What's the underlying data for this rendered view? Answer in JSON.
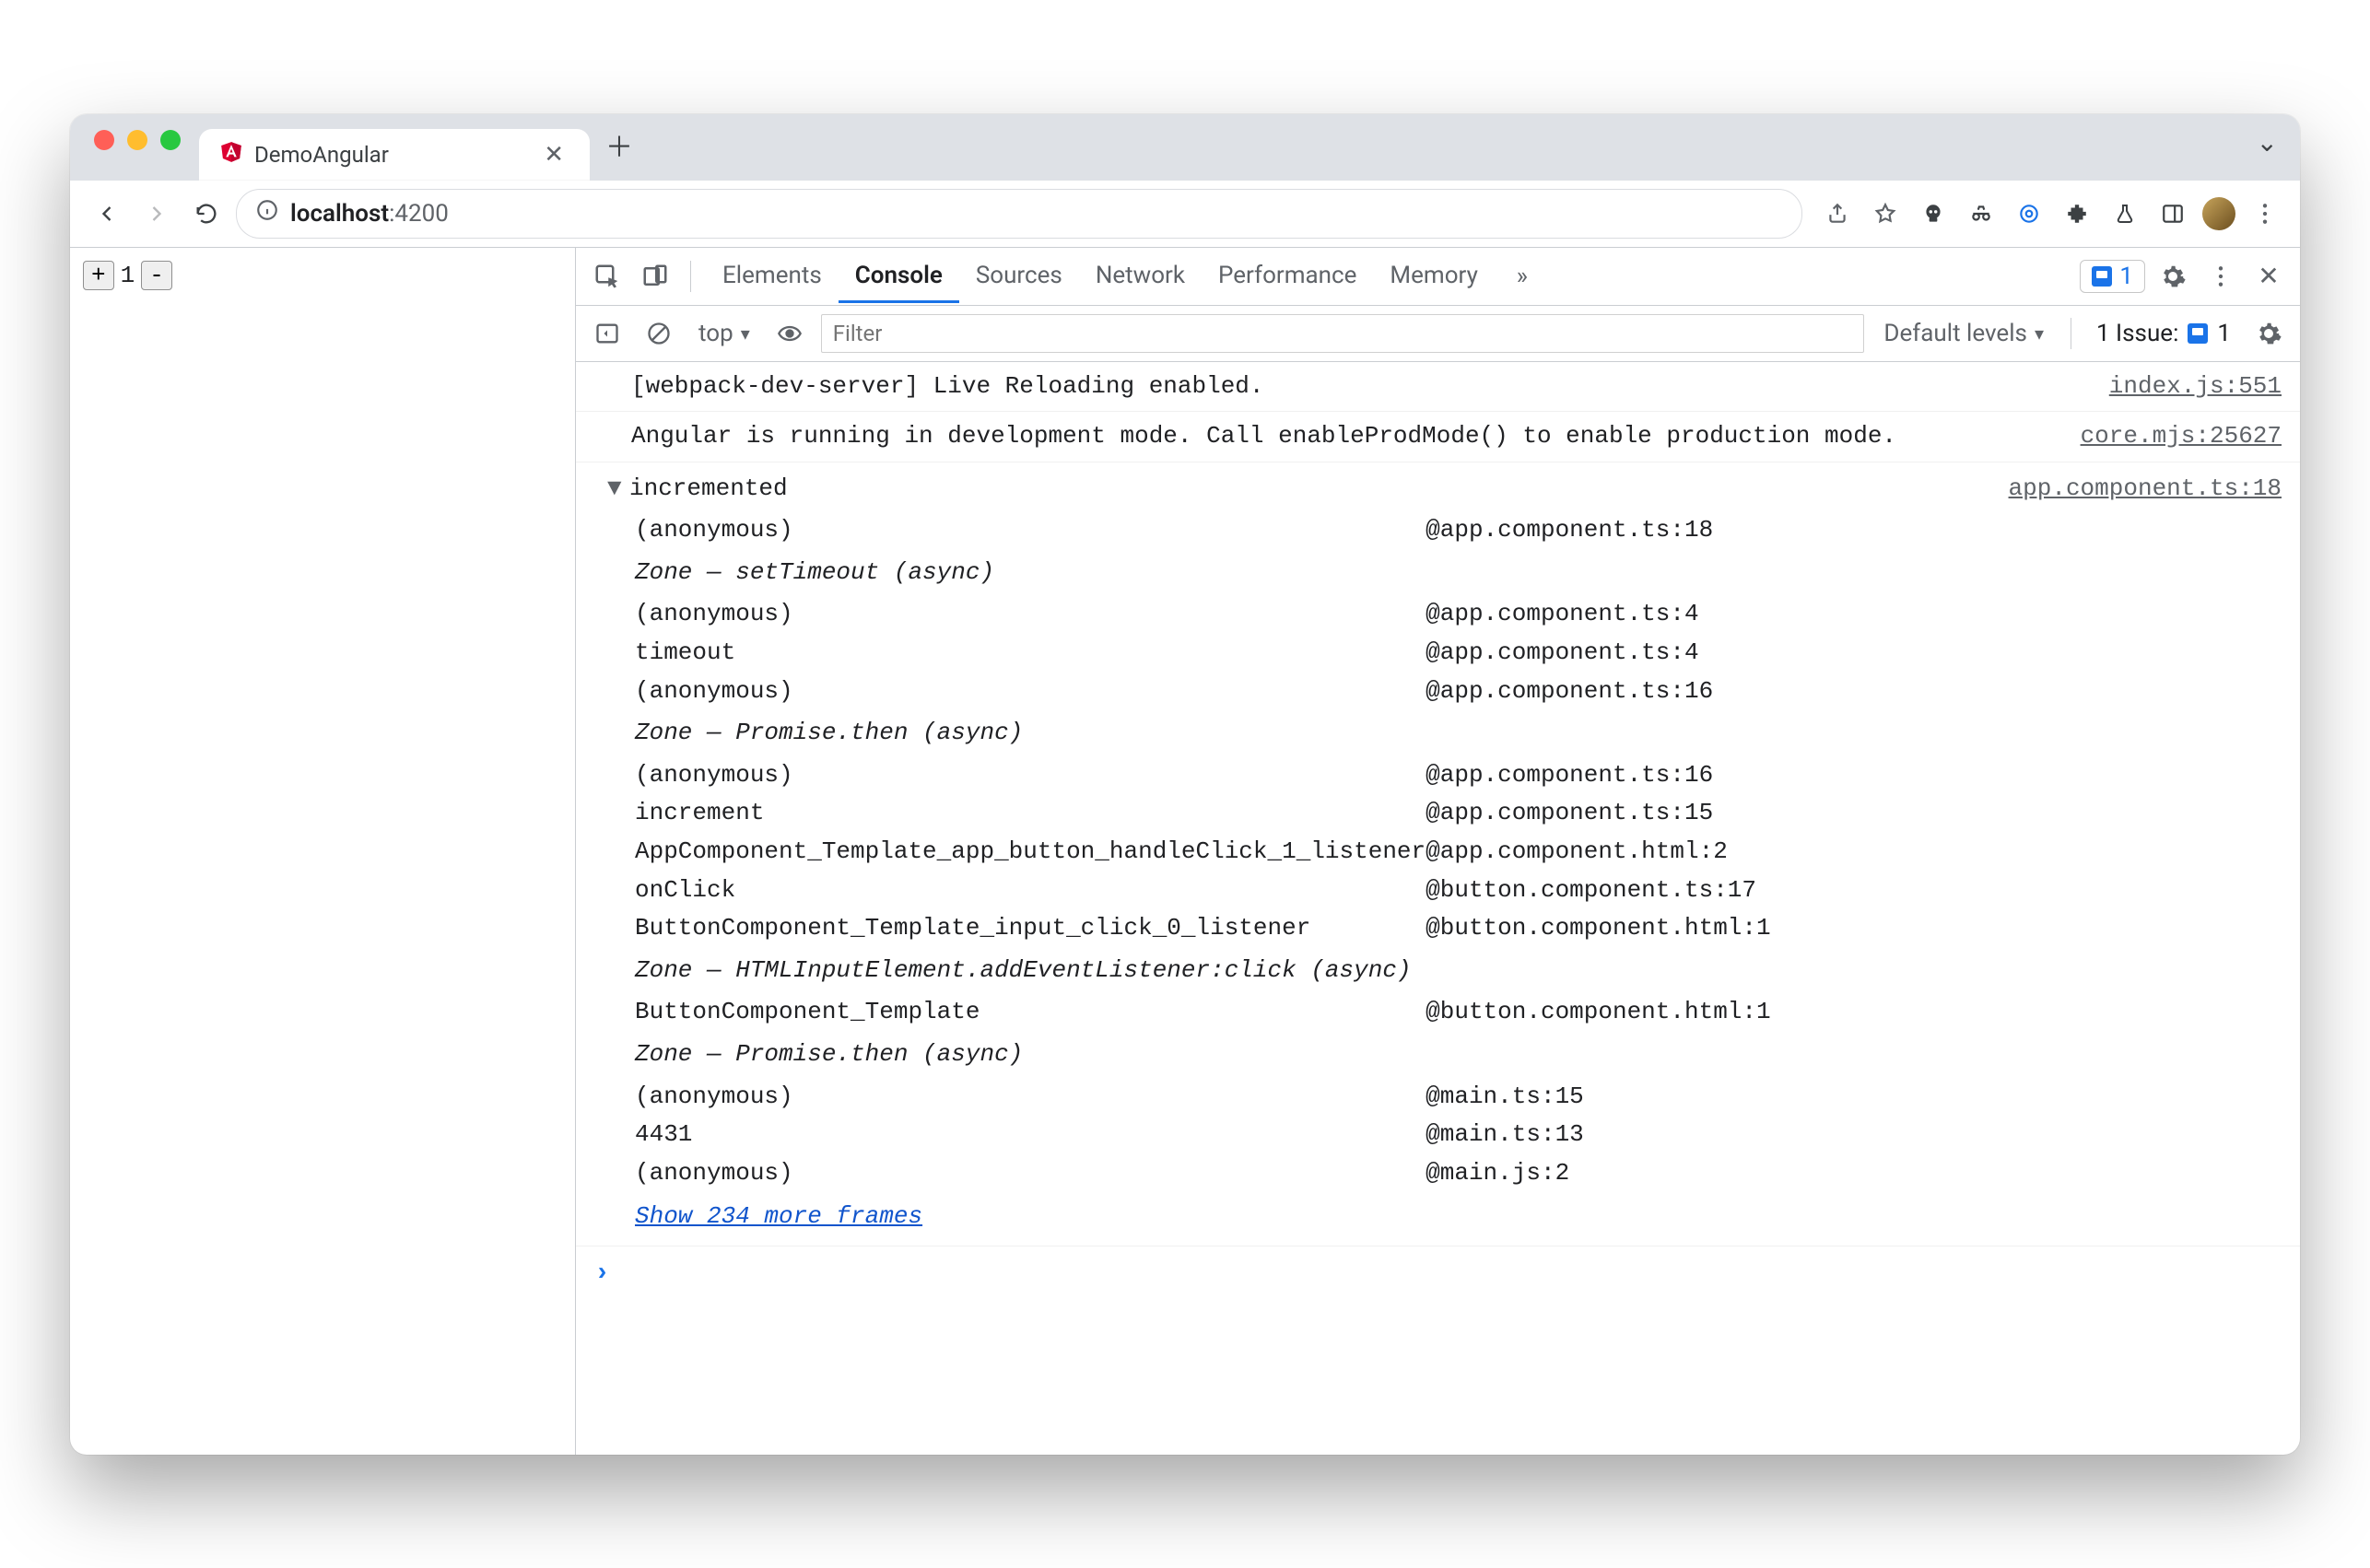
{
  "window": {
    "tab_title": "DemoAngular",
    "url_host": "localhost",
    "url_port": ":4200",
    "messages_badge": "1"
  },
  "page": {
    "plus": "+",
    "count": "1",
    "minus": "-"
  },
  "devtools": {
    "tabs": [
      "Elements",
      "Console",
      "Sources",
      "Network",
      "Performance",
      "Memory"
    ],
    "active_tab": "Console",
    "toolbar": {
      "context": "top",
      "filter_placeholder": "Filter",
      "levels": "Default levels",
      "issues_label": "1 Issue:",
      "issues_count": "1"
    },
    "logs": [
      {
        "msg": "[webpack-dev-server] Live Reloading enabled.",
        "src": "index.js:551"
      },
      {
        "msg": "Angular is running in development mode. Call enableProdMode() to enable production mode.",
        "src": "core.mjs:25627"
      }
    ],
    "trace": {
      "label": "incremented",
      "src": "app.component.ts:18",
      "frames": [
        {
          "fn": "(anonymous)",
          "loc": "app.component.ts:18"
        },
        {
          "zone": "Zone — setTimeout (async)"
        },
        {
          "fn": "(anonymous)",
          "loc": "app.component.ts:4"
        },
        {
          "fn": "timeout",
          "loc": "app.component.ts:4"
        },
        {
          "fn": "(anonymous)",
          "loc": "app.component.ts:16"
        },
        {
          "zone": "Zone — Promise.then (async)"
        },
        {
          "fn": "(anonymous)",
          "loc": "app.component.ts:16"
        },
        {
          "fn": "increment",
          "loc": "app.component.ts:15"
        },
        {
          "fn": "AppComponent_Template_app_button_handleClick_1_listener",
          "loc": "app.component.html:2"
        },
        {
          "fn": "onClick",
          "loc": "button.component.ts:17"
        },
        {
          "fn": "ButtonComponent_Template_input_click_0_listener",
          "loc": "button.component.html:1"
        },
        {
          "zone": "Zone — HTMLInputElement.addEventListener:click (async)"
        },
        {
          "fn": "ButtonComponent_Template",
          "loc": "button.component.html:1"
        },
        {
          "zone": "Zone — Promise.then (async)"
        },
        {
          "fn": "(anonymous)",
          "loc": "main.ts:15"
        },
        {
          "fn": "4431",
          "loc": "main.ts:13"
        },
        {
          "fn": "(anonymous)",
          "loc": "main.js:2"
        }
      ],
      "show_more": "Show 234 more frames"
    },
    "prompt": "›"
  }
}
